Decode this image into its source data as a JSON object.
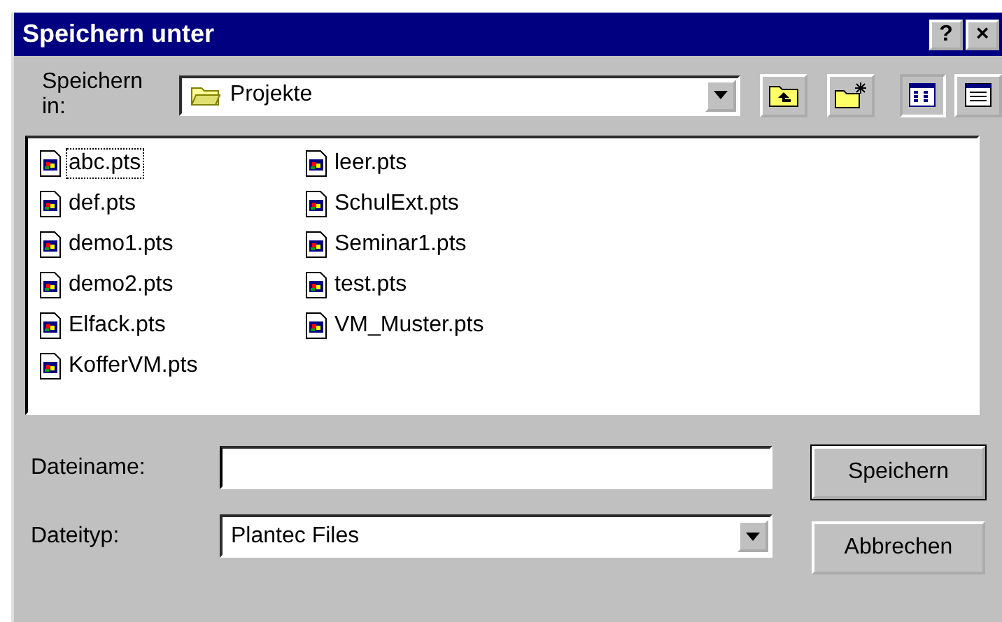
{
  "window": {
    "title": "Speichern unter",
    "title_buttons": [
      "?",
      "×"
    ]
  },
  "location": {
    "label": "Speichern in:",
    "value": "Projekte"
  },
  "files": [
    [
      {
        "name": "abc.pts",
        "focused": true
      },
      {
        "name": "def.pts",
        "focused": false
      },
      {
        "name": "demo1.pts",
        "focused": false
      },
      {
        "name": "demo2.pts",
        "focused": false
      },
      {
        "name": "Elfack.pts",
        "focused": false
      },
      {
        "name": "KofferVM.pts",
        "focused": false
      }
    ],
    [
      {
        "name": "leer.pts",
        "focused": false
      },
      {
        "name": "SchulExt.pts",
        "focused": false
      },
      {
        "name": "Seminar1.pts",
        "focused": false
      },
      {
        "name": "test.pts",
        "focused": false
      },
      {
        "name": "VM_Muster.pts",
        "focused": false
      }
    ]
  ],
  "filename": {
    "label": "Dateiname:"
  },
  "filetype": {
    "label": "Dateityp:",
    "value": "Plantec Files"
  },
  "buttons": [
    {
      "label": "Speichern",
      "default": true
    },
    {
      "label": "Abbrechen",
      "default": false
    }
  ]
}
